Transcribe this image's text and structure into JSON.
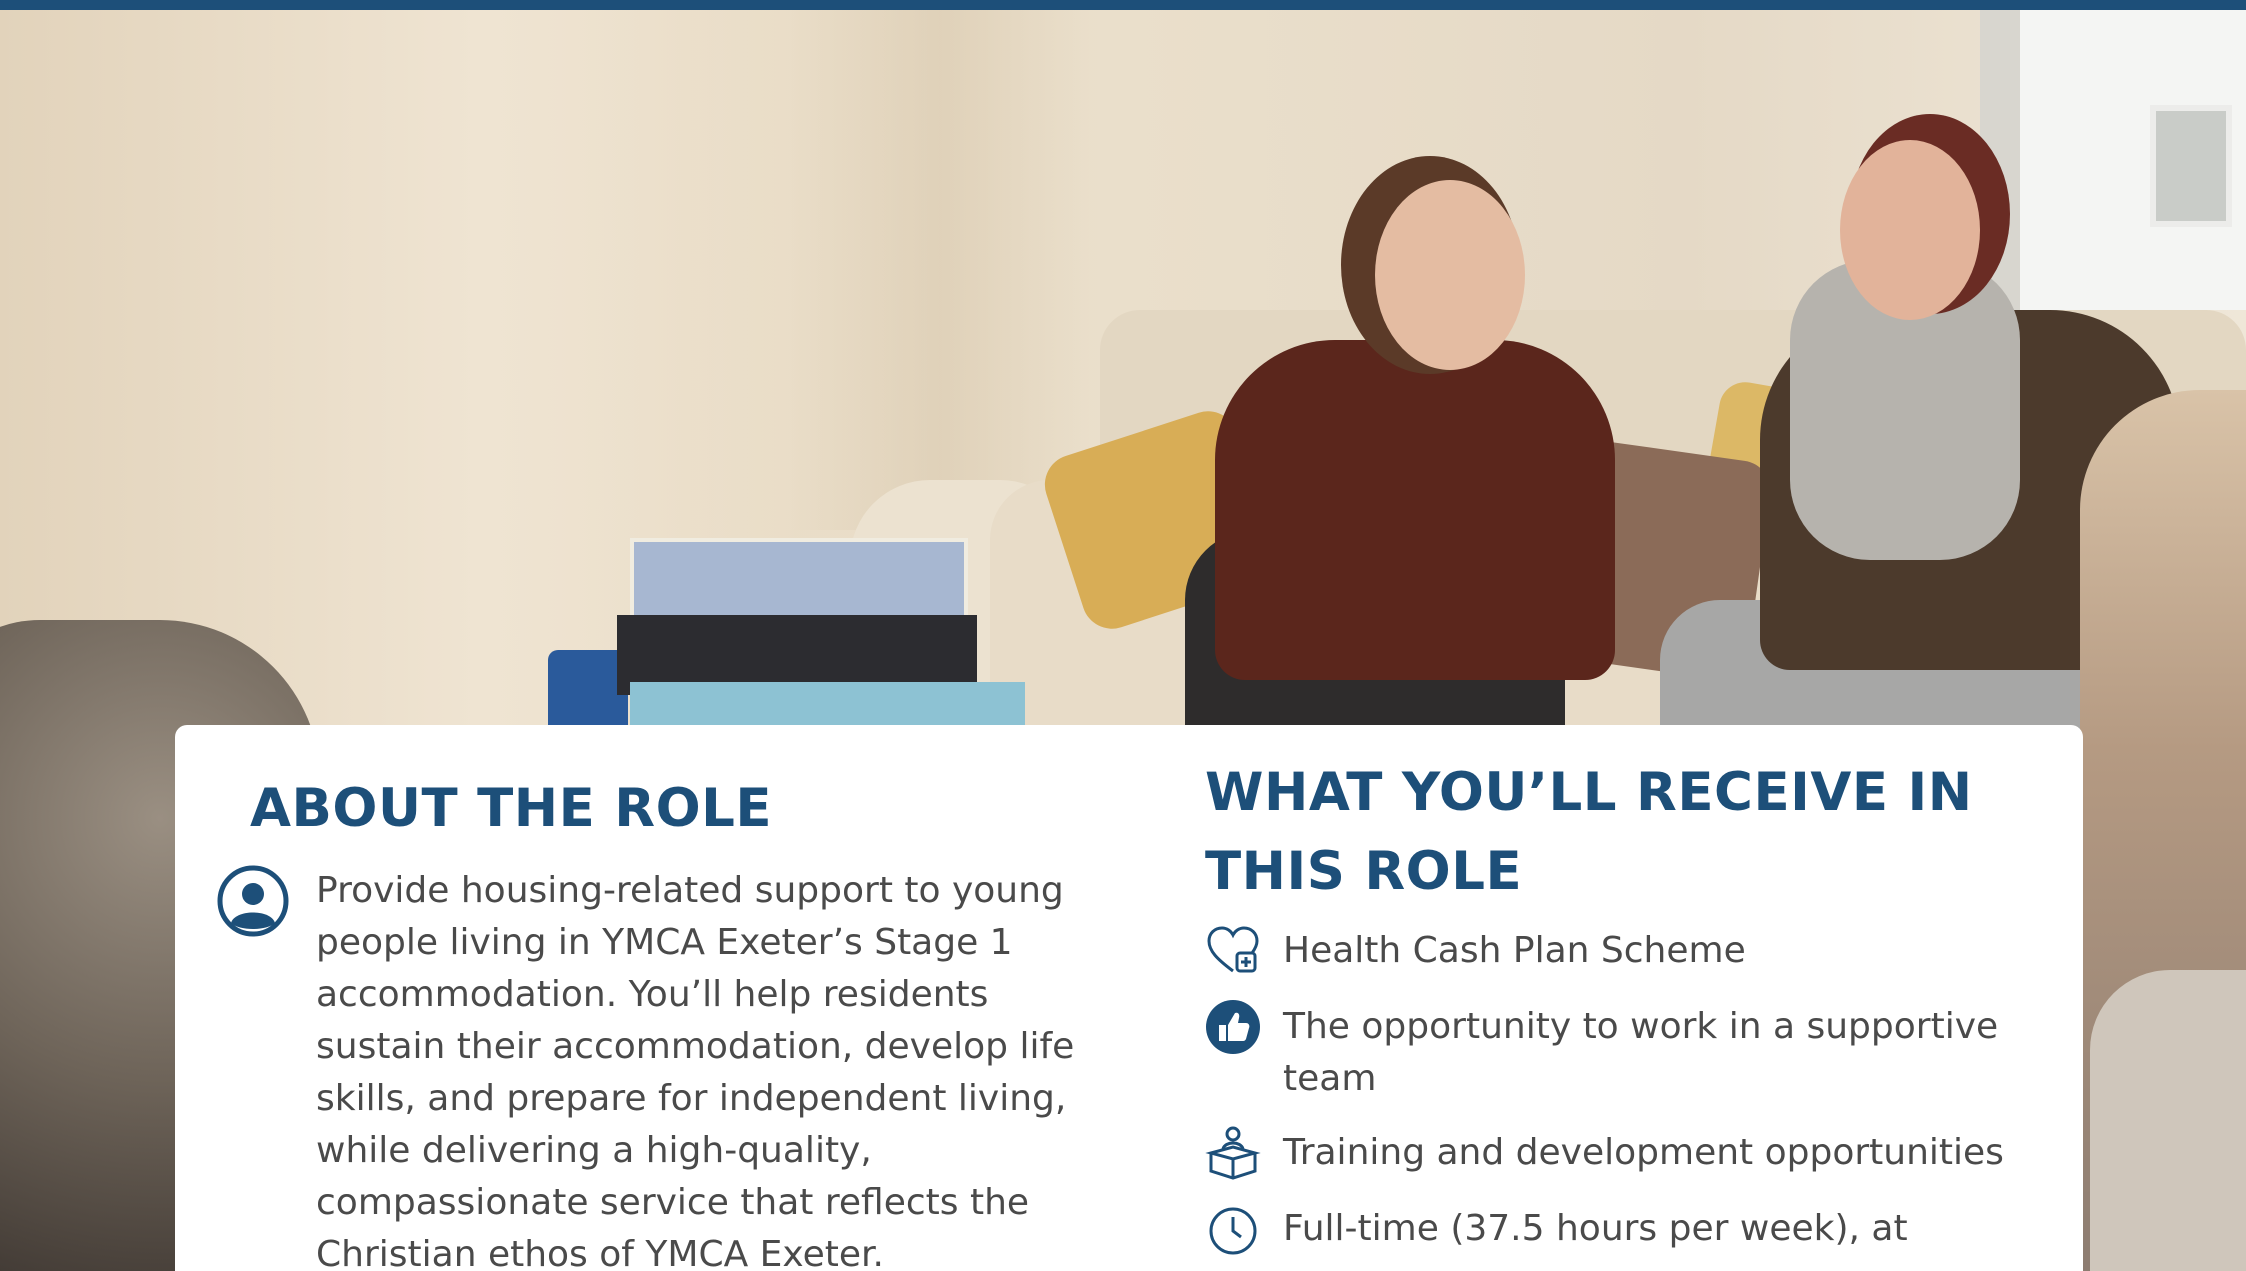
{
  "colors": {
    "brand_blue": "#1d4f79",
    "body_text": "#4a4a4a",
    "card_background": "#ffffff"
  },
  "hero": {
    "image_subject": "two-women-talking-on-sofa"
  },
  "about": {
    "heading": "ABOUT THE ROLE",
    "icon": "user-icon",
    "text": "Provide housing-related support to young people living in YMCA Exeter’s Stage 1 accommodation. You’ll help residents sustain their accommodation, develop life skills, and prepare for independent living, while delivering a high-quality, compassionate service that reflects the Christian ethos of YMCA Exeter."
  },
  "receive": {
    "heading": "WHAT YOU’LL RECEIVE IN THIS ROLE",
    "items": [
      {
        "icon": "heart-plus-icon",
        "label": "Health Cash Plan Scheme"
      },
      {
        "icon": "thumbs-up-icon",
        "label": "The opportunity to work in a supportive team"
      },
      {
        "icon": "person-box-icon",
        "label": "Training and development opportunities"
      },
      {
        "icon": "clock-icon",
        "label": "Full-time (37.5 hours per week), at"
      }
    ]
  }
}
